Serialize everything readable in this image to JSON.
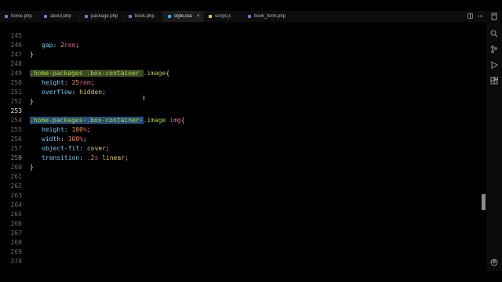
{
  "tabs": [
    {
      "label": "home.php",
      "icon": "php-file-icon",
      "color": "#8a6fd1",
      "active": false
    },
    {
      "label": "about.php",
      "icon": "php-file-icon",
      "color": "#8a6fd1",
      "active": false
    },
    {
      "label": "package.php",
      "icon": "php-file-icon",
      "color": "#8a6fd1",
      "active": false
    },
    {
      "label": "book.php",
      "icon": "php-file-icon",
      "color": "#8a6fd1",
      "active": false
    },
    {
      "label": "style.css",
      "icon": "css-file-icon",
      "color": "#3fa9f5",
      "active": true
    },
    {
      "label": "script.js",
      "icon": "js-file-icon",
      "color": "#e8c547",
      "active": false
    },
    {
      "label": "book_form.php",
      "icon": "php-file-icon",
      "color": "#8a6fd1",
      "active": false
    }
  ],
  "close_glyph": "×",
  "line_numbers": [
    "245",
    "246",
    "247",
    "248",
    "249",
    "250",
    "251",
    "252",
    "253",
    "254",
    "255",
    "256",
    "257",
    "258",
    "259",
    "260",
    "261",
    "262",
    "263",
    "264",
    "265",
    "266",
    "267",
    "268",
    "269",
    "270"
  ],
  "current_line": "253",
  "code": {
    "l245": {
      "prop": "gap",
      "value": "2rem",
      "num": "2",
      "unit": "rem"
    },
    "l246": "}",
    "l248_sel1": ".home-packages",
    "l248_sel2": ".box-container",
    "l248_sel3": ".image",
    "l249": {
      "prop": "height",
      "num": "25",
      "unit": "rem"
    },
    "l250": {
      "prop": "overflow",
      "kw": "hidden"
    },
    "l251": "}",
    "l253_sel1": ".home-packages",
    "l253_sel2": ".box-container",
    "l253_sel3": ".image",
    "l253_tag": "img",
    "l254": {
      "prop": "height",
      "num": "100",
      "unit": "%"
    },
    "l255": {
      "prop": "width",
      "num": "100",
      "unit": "%"
    },
    "l256": {
      "prop": "object-fit",
      "kw": "cover"
    },
    "l257": {
      "prop": "transition",
      "num": ".2",
      "unit": "s",
      "kw": "linear"
    },
    "l258": "}"
  },
  "colors": {
    "selector": "#a8d24a",
    "property": "#78c8f0",
    "number": "#e58c5a",
    "unit": "#e0508a",
    "keyword": "#e6c86e",
    "tag": "#ec6e8c"
  }
}
